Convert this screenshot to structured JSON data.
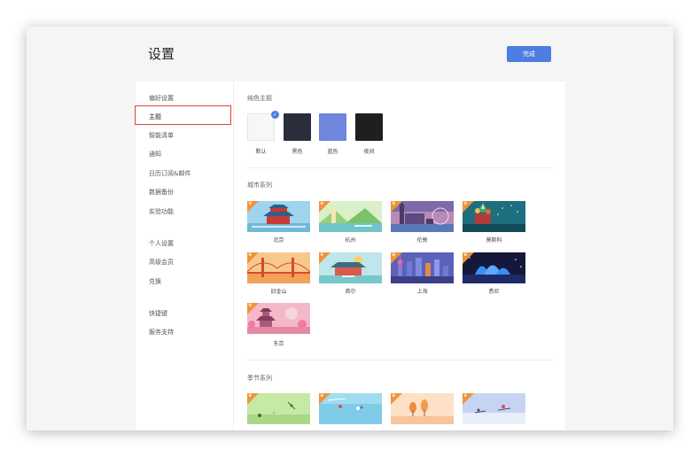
{
  "header": {
    "title": "设置",
    "done_label": "完成"
  },
  "sidebar": {
    "items": [
      {
        "label": "偏好设置"
      },
      {
        "label": "主题"
      },
      {
        "label": "智能清单"
      },
      {
        "label": "通知"
      },
      {
        "label": "日历订阅&邮件"
      },
      {
        "label": "数据备份"
      },
      {
        "label": "实验功能"
      },
      {
        "label": "个人设置"
      },
      {
        "label": "高级会员"
      },
      {
        "label": "兑换"
      },
      {
        "label": "快捷键"
      },
      {
        "label": "服务支持"
      }
    ],
    "active": "主题"
  },
  "themes": {
    "solid": {
      "title": "纯色主题",
      "items": [
        {
          "label": "默认",
          "color": "#f7f7f7",
          "selected": true
        },
        {
          "label": "黑色",
          "color": "#2b2e3a"
        },
        {
          "label": "蓝色",
          "color": "#6e86dc"
        },
        {
          "label": "夜间",
          "color": "#1f1f1f"
        }
      ]
    },
    "city": {
      "title": "城市系列",
      "items": [
        {
          "label": "北京"
        },
        {
          "label": "杭州"
        },
        {
          "label": "伦敦"
        },
        {
          "label": "莫斯科"
        },
        {
          "label": "旧金山"
        },
        {
          "label": "首尔"
        },
        {
          "label": "上海"
        },
        {
          "label": "悉尼"
        },
        {
          "label": "东京"
        }
      ]
    },
    "season": {
      "title": "季节系列",
      "items": [
        {},
        {},
        {},
        {}
      ]
    }
  },
  "colors": {
    "accent": "#4e7de2",
    "highlight": "#e2403a",
    "premium_badge": "#f0943a"
  }
}
